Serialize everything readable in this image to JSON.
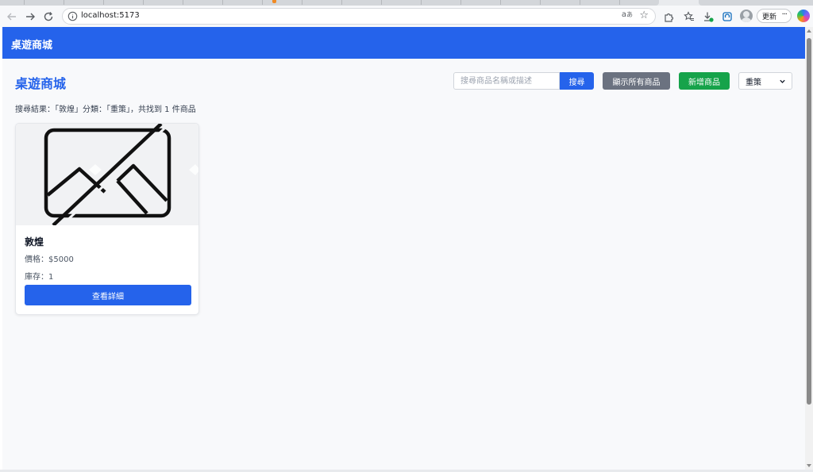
{
  "browser": {
    "url": "localhost:5173",
    "update_label": "更新",
    "more_label": "···",
    "icons": [
      "back-arrow-icon",
      "forward-arrow-icon",
      "reload-icon",
      "site-info-icon",
      "read-aloud-icon",
      "favorite-star-icon",
      "extensions-icon",
      "favorites-icon",
      "downloads-icon",
      "collections-icon",
      "profile-avatar-icon",
      "copilot-icon"
    ]
  },
  "navbar": {
    "brand": "桌遊商城",
    "color": "#2563eb"
  },
  "header": {
    "title": "桌遊商城",
    "search_placeholder": "搜尋商品名稱或描述",
    "search_button": "搜尋",
    "show_all_button": "顯示所有商品",
    "add_button": "新增商品",
    "category_selected": "重策"
  },
  "results": {
    "summary": "搜尋結果：「敦煌」分類：「重策」，共找到 1 件商品"
  },
  "products": [
    {
      "name": "敦煌",
      "price": "價格：$5000",
      "stock": "庫存：1",
      "detail_button": "查看詳細",
      "image_icon": "broken-image-icon"
    }
  ],
  "colors": {
    "primary": "#2563eb",
    "secondary": "#6b7280",
    "success": "#16a34a",
    "page_bg": "#f8f9fb"
  }
}
